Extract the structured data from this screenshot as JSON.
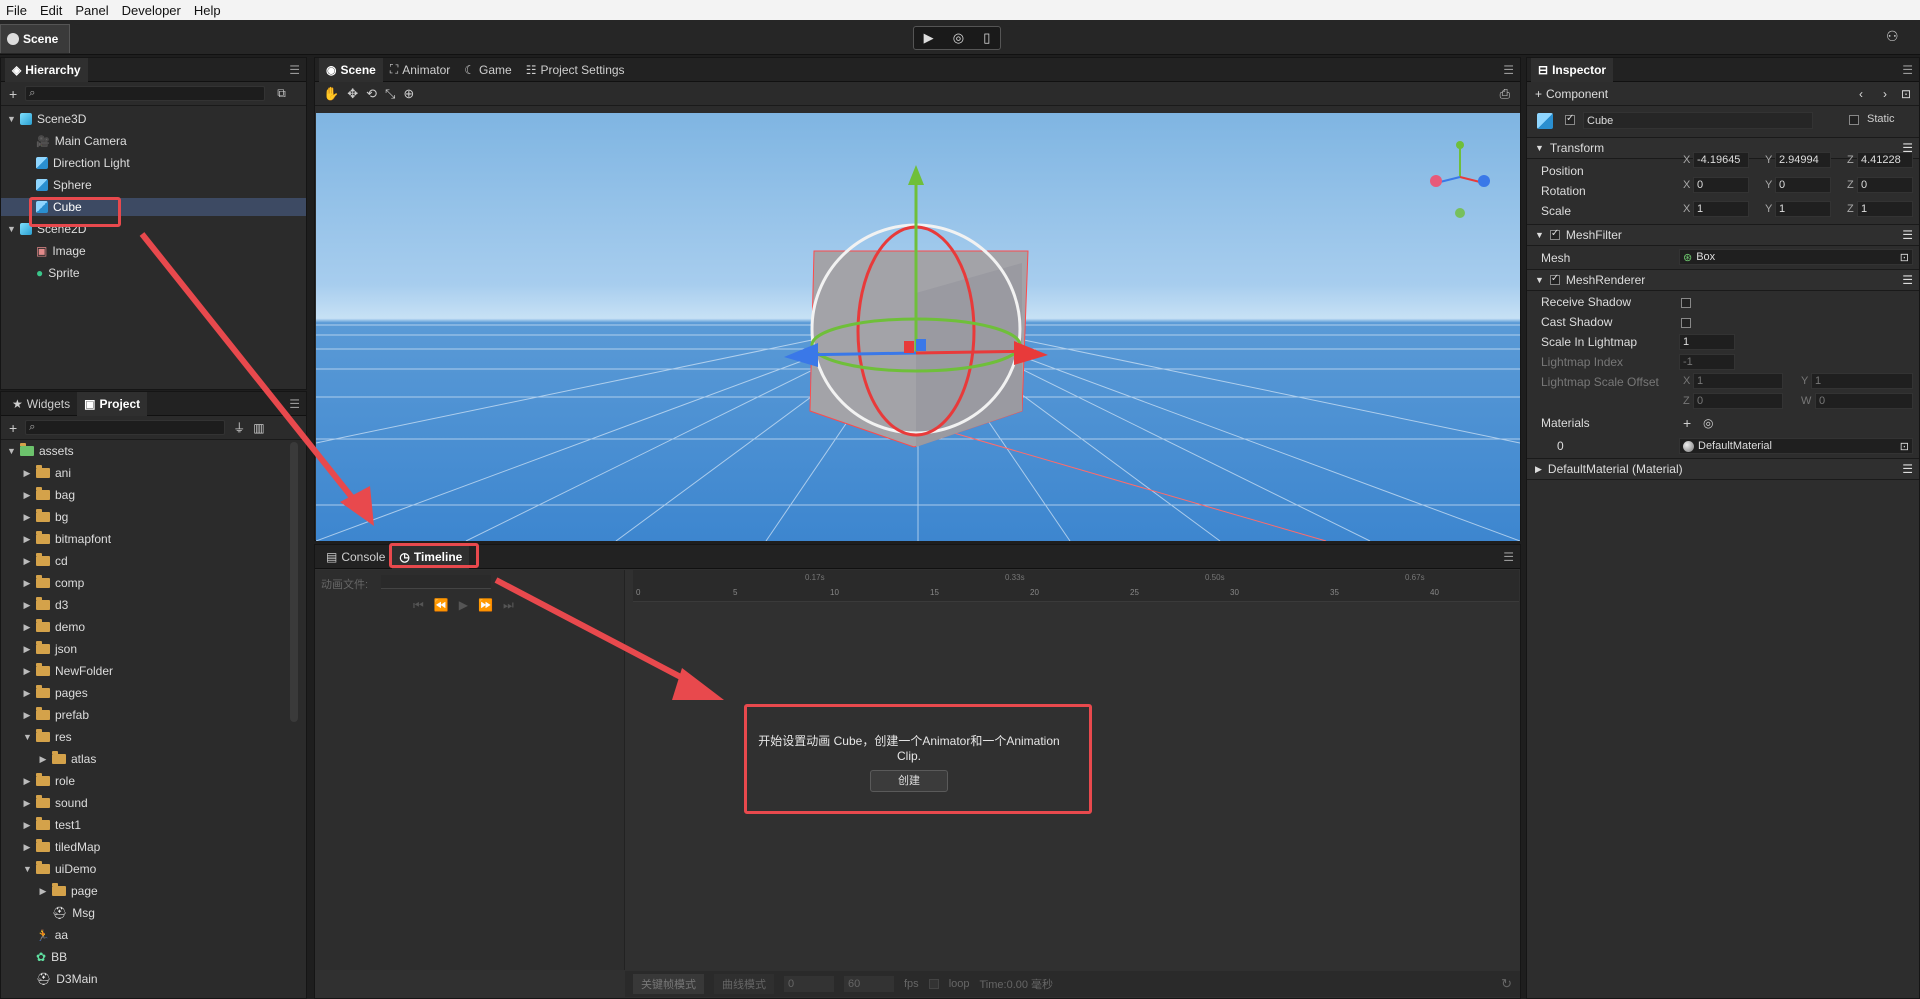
{
  "menu": [
    "File",
    "Edit",
    "Panel",
    "Developer",
    "Help"
  ],
  "title_tab": "Scene",
  "hierarchy": {
    "tab": "Hierarchy",
    "items": [
      {
        "label": "Scene3D",
        "indent": 0,
        "expanded": true,
        "kind": "scene"
      },
      {
        "label": "Main Camera",
        "indent": 1,
        "kind": "camera"
      },
      {
        "label": "Direction Light",
        "indent": 1,
        "kind": "cube"
      },
      {
        "label": "Sphere",
        "indent": 1,
        "kind": "cube"
      },
      {
        "label": "Cube",
        "indent": 1,
        "kind": "cube",
        "selected": true
      },
      {
        "label": "Scene2D",
        "indent": 0,
        "expanded": true,
        "kind": "scene"
      },
      {
        "label": "Image",
        "indent": 1,
        "kind": "image"
      },
      {
        "label": "Sprite",
        "indent": 1,
        "kind": "sprite"
      }
    ]
  },
  "project": {
    "tabs": [
      "Widgets",
      "Project"
    ],
    "items": [
      {
        "label": "assets",
        "indent": 0,
        "expanded": true,
        "kind": "root"
      },
      {
        "label": "ani",
        "indent": 1,
        "kind": "folder"
      },
      {
        "label": "bag",
        "indent": 1,
        "kind": "folder"
      },
      {
        "label": "bg",
        "indent": 1,
        "kind": "folder"
      },
      {
        "label": "bitmapfont",
        "indent": 1,
        "kind": "folder"
      },
      {
        "label": "cd",
        "indent": 1,
        "kind": "folder"
      },
      {
        "label": "comp",
        "indent": 1,
        "kind": "folder"
      },
      {
        "label": "d3",
        "indent": 1,
        "kind": "folder"
      },
      {
        "label": "demo",
        "indent": 1,
        "kind": "folder"
      },
      {
        "label": "json",
        "indent": 1,
        "kind": "folder"
      },
      {
        "label": "NewFolder",
        "indent": 1,
        "kind": "folder"
      },
      {
        "label": "pages",
        "indent": 1,
        "kind": "folder"
      },
      {
        "label": "prefab",
        "indent": 1,
        "kind": "folder"
      },
      {
        "label": "res",
        "indent": 1,
        "kind": "folder",
        "expanded": true
      },
      {
        "label": "atlas",
        "indent": 2,
        "kind": "folder"
      },
      {
        "label": "role",
        "indent": 1,
        "kind": "folder"
      },
      {
        "label": "sound",
        "indent": 1,
        "kind": "folder"
      },
      {
        "label": "test1",
        "indent": 1,
        "kind": "folder"
      },
      {
        "label": "tiledMap",
        "indent": 1,
        "kind": "folder"
      },
      {
        "label": "uiDemo",
        "indent": 1,
        "kind": "folder",
        "expanded": true
      },
      {
        "label": "page",
        "indent": 2,
        "kind": "folder"
      },
      {
        "label": "Msg",
        "indent": 2,
        "kind": "prefab"
      },
      {
        "label": "aa",
        "indent": 1,
        "kind": "anim"
      },
      {
        "label": "BB",
        "indent": 1,
        "kind": "prefab2"
      },
      {
        "label": "D3Main",
        "indent": 1,
        "kind": "prefab"
      }
    ]
  },
  "center_tabs": [
    "Scene",
    "Animator",
    "Game",
    "Project Settings"
  ],
  "bottom_tabs": [
    "Console",
    "Timeline"
  ],
  "timeline": {
    "file_label": "动画文件:",
    "time_marks": [
      "0.17s",
      "0.33s",
      "0.50s",
      "0.67s"
    ],
    "frame_marks": [
      "0",
      "5",
      "10",
      "15",
      "20",
      "25",
      "30",
      "35",
      "40"
    ],
    "dialog_text": "开始设置动画 Cube，创建一个Animator和一个Animation Clip.",
    "create_button": "创建",
    "footer": {
      "keyframe_mode": "关键帧模式",
      "curve_mode": "曲线模式",
      "frame": "0",
      "fps_value": "60",
      "fps_label": "fps",
      "loop_label": "loop",
      "time_label": "Time:0.00 毫秒"
    }
  },
  "inspector": {
    "tab": "Inspector",
    "add_component": "Component",
    "object_name": "Cube",
    "static_label": "Static",
    "transform": {
      "title": "Transform",
      "position_label": "Position",
      "position": [
        "-4.19645",
        "2.94994",
        "4.41228"
      ],
      "rotation_label": "Rotation",
      "rotation": [
        "0",
        "0",
        "0"
      ],
      "scale_label": "Scale",
      "scale": [
        "1",
        "1",
        "1"
      ]
    },
    "mesh_filter": {
      "title": "MeshFilter",
      "mesh_label": "Mesh",
      "mesh_value": "Box"
    },
    "mesh_renderer": {
      "title": "MeshRenderer",
      "receive_shadow": "Receive Shadow",
      "cast_shadow": "Cast Shadow",
      "scale_in_lightmap": "Scale In Lightmap",
      "scale_in_lightmap_value": "1",
      "lightmap_index": "Lightmap Index",
      "lightmap_index_value": "-1",
      "lightmap_scale_offset": "Lightmap Scale Offset",
      "lso_x": "1",
      "lso_y": "1",
      "lso_z": "0",
      "lso_w": "0",
      "materials": "Materials",
      "material_index": "0",
      "material_value": "DefaultMaterial"
    },
    "material_section": "DefaultMaterial (Material)"
  },
  "colors": {
    "highlight": "#e8494d",
    "selection": "#3d4a63",
    "accent": "#5fa6e8"
  }
}
